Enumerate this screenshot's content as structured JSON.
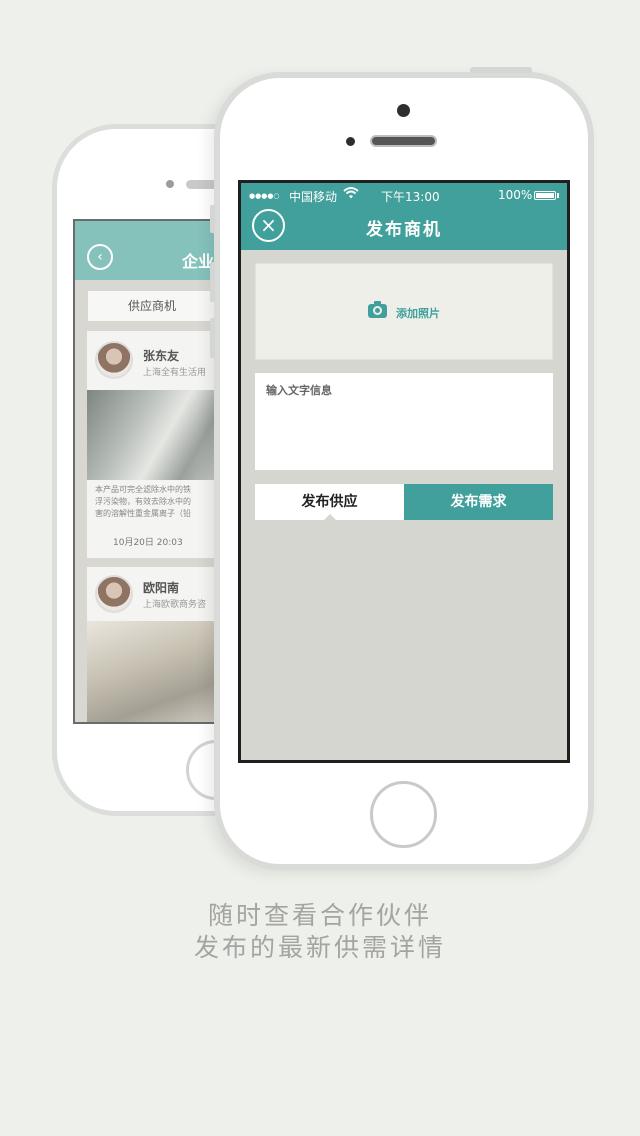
{
  "back_phone": {
    "title": "企业",
    "tab_label": "供应商机",
    "cards": [
      {
        "name": "张东友",
        "company": "上海全有生活用"
      },
      {
        "name": "欧阳南",
        "company": "上海欧歌商务咨"
      }
    ],
    "desc_lines": [
      "本产品可完全滤除水中的铁",
      "浮污染物，有效去除水中的",
      "害的溶解性重金属离子（铅"
    ],
    "time": "10月20日  20:03"
  },
  "status_bar": {
    "signal": "●●●●○",
    "carrier": "中国移动",
    "time": "下午13:00",
    "battery": "100%"
  },
  "header": {
    "close_icon": "×",
    "title": "发布商机"
  },
  "form": {
    "add_photo_label": "添加照片",
    "text_placeholder": "输入文字信息"
  },
  "tabs": {
    "supply": "发布供应",
    "demand": "发布需求"
  },
  "caption": {
    "line1": "随时查看合作伙伴",
    "line2": "发布的最新供需详情"
  },
  "colors": {
    "accent": "#41a09b",
    "back_header": "#86c2bc",
    "background": "#eef0eb",
    "screen_bg": "#d6d6d1"
  }
}
